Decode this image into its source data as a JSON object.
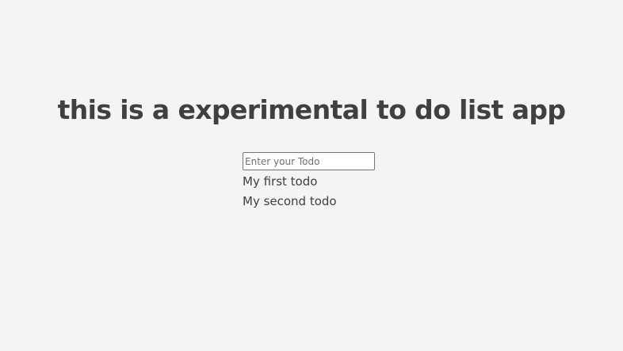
{
  "header": {
    "title": "this is a experimental to do list app"
  },
  "todo_input": {
    "placeholder": "Enter your Todo",
    "value": ""
  },
  "todos": [
    {
      "text": "My first todo"
    },
    {
      "text": "My second todo"
    }
  ],
  "colors": {
    "background": "#f4f4f4",
    "text": "#404040",
    "input_border": "#767676"
  }
}
